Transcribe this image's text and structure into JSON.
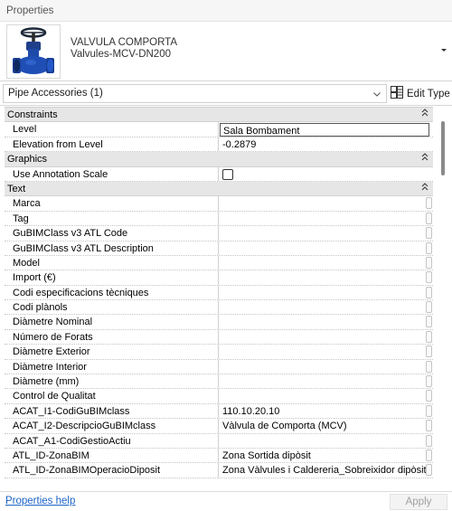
{
  "palette": {
    "title": "Properties"
  },
  "type_selector": {
    "family": "VALVULA COMPORTA",
    "type": "Valvules-MCV-DN200"
  },
  "instance_selector": {
    "value": "Pipe Accessories (1)",
    "edit_type_label": "Edit Type"
  },
  "groups": [
    {
      "name": "Constraints",
      "params": [
        {
          "name": "Level",
          "value": "Sala Bombament",
          "editing": true
        },
        {
          "name": "Elevation from Level",
          "value": "-0.2879"
        }
      ]
    },
    {
      "name": "Graphics",
      "params": [
        {
          "name": "Use Annotation Scale",
          "value": "",
          "checkbox": true,
          "checked": false
        }
      ]
    },
    {
      "name": "Text",
      "params": [
        {
          "name": "Marca",
          "value": ""
        },
        {
          "name": "Tag",
          "value": ""
        },
        {
          "name": "GuBIMClass v3 ATL Code",
          "value": ""
        },
        {
          "name": "GuBIMClass v3 ATL Description",
          "value": ""
        },
        {
          "name": "Model",
          "value": ""
        },
        {
          "name": "Import (€)",
          "value": ""
        },
        {
          "name": "Codi especificacions tècniques",
          "value": ""
        },
        {
          "name": "Codi plànols",
          "value": ""
        },
        {
          "name": "Diàmetre Nominal",
          "value": ""
        },
        {
          "name": "Número de Forats",
          "value": ""
        },
        {
          "name": "Diàmetre Exterior",
          "value": ""
        },
        {
          "name": "Diàmetre Interior",
          "value": ""
        },
        {
          "name": "Diàmetre (mm)",
          "value": ""
        },
        {
          "name": "Control de Qualitat",
          "value": ""
        },
        {
          "name": "ACAT_I1-CodiGuBIMclass",
          "value": "110.10.20.10"
        },
        {
          "name": "ACAT_I2-DescripcioGuBIMclass",
          "value": "Vàlvula de Comporta (MCV)"
        },
        {
          "name": "ACAT_A1-CodiGestioActiu",
          "value": ""
        },
        {
          "name": "ATL_ID-ZonaBIM",
          "value": "Zona Sortida dipòsit"
        },
        {
          "name": "ATL_ID-ZonaBIMOperacioDiposit",
          "value": "Zona Vàlvules i Caldereria_Sobreixidor dipòsit"
        }
      ]
    }
  ],
  "footer": {
    "help_link": "Properties help",
    "apply_label": "Apply"
  }
}
